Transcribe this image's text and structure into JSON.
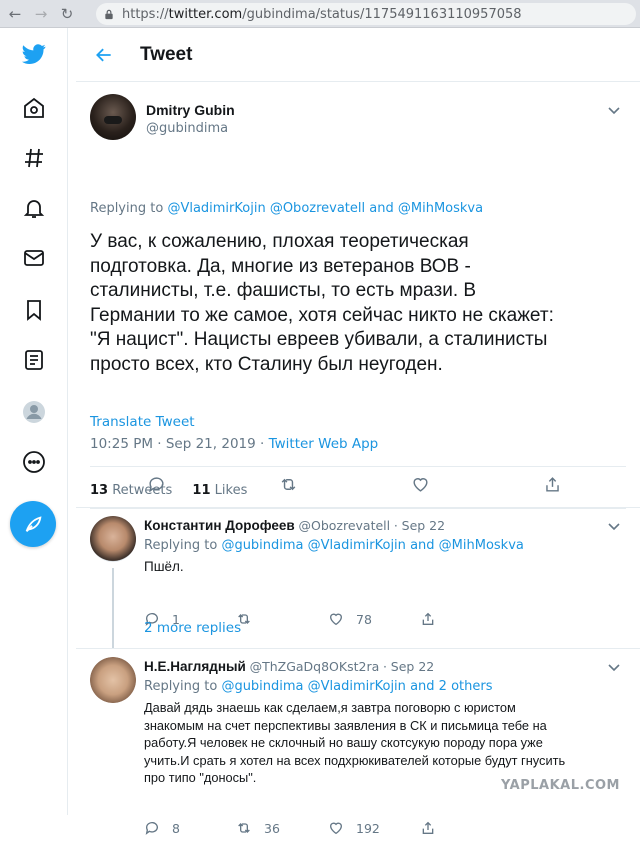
{
  "browser": {
    "url_scheme": "https://",
    "url_host": "twitter.com",
    "url_path": "/gubindima/status/1175491163110957058"
  },
  "header": {
    "title": "Tweet"
  },
  "tweet": {
    "author_name": "Dmitry Gubin",
    "author_handle": "@gubindima",
    "replying_prefix": "Replying to",
    "replying_to": [
      "@VladimirKojin",
      "@Obozrevatell",
      "@MihMoskva"
    ],
    "replying_and": "and",
    "text_lines": [
      "У вас, к сожалению, плохая теоретическая",
      "подготовка. Да, многие из ветеранов ВОВ -",
      "сталинисты, т.е. фашисты, то есть мрази. В",
      "Германии то же самое, хотя сейчас никто не скажет:",
      "\"Я нацист\". Нацисты евреев убивали, а сталинисты",
      "просто всех, кто Сталину был неугоден."
    ],
    "translate_label": "Translate Tweet",
    "time": "10:25 PM · Sep 21, 2019 · ",
    "source": "Twitter Web App",
    "retweets_count": "13",
    "retweets_label": "Retweets",
    "likes_count": "11",
    "likes_label": "Likes"
  },
  "replies": [
    {
      "name": "Константин Дорофеев",
      "handle": "@Obozrevatell",
      "date": "Sep 22",
      "replying_prefix": "Replying to",
      "replying_links": "@gubindima @VladimirKojin",
      "replying_and": "and",
      "replying_last": "@MihMoskva",
      "text": "Пшёл.",
      "reply_count": "1",
      "retweet_count": "",
      "like_count": "78",
      "more_replies": "2 more replies"
    },
    {
      "name": "Н.Е.Наглядный",
      "handle": "@ThZGaDq8OKst2ra",
      "date": "Sep 22",
      "replying_prefix": "Replying to",
      "replying_links": "@gubindima @VladimirKojin",
      "replying_and": "and",
      "replying_last": "2 others",
      "text_lines": [
        "Давай дядь знаешь как сделаем,я завтра поговорю с юристом",
        "знакомым на счет перспективы заявления в СК и письмица тебе на",
        "работу.Я человек не склочный но вашу скотсукую породу пора уже",
        "учить.И срать я хотел на всех подхрюкивателей которые будут гнусить",
        "про типо \"доносы\"."
      ],
      "reply_count": "8",
      "retweet_count": "36",
      "like_count": "192"
    }
  ],
  "watermark": "YAPLAKAL.COM",
  "colors": {
    "accent": "#1da1f2",
    "link": "#1b95e0",
    "muted": "#657786"
  }
}
